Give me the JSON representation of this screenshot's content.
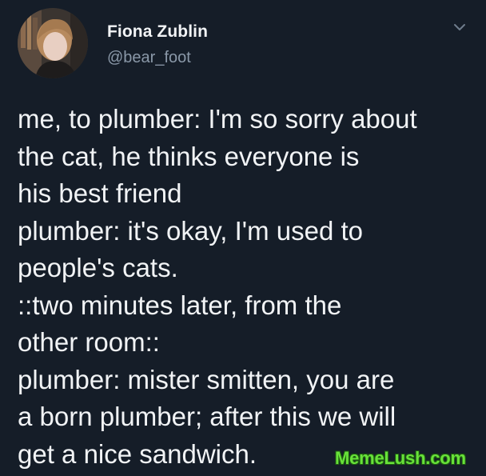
{
  "tweet": {
    "author": {
      "display_name": "Fiona Zublin",
      "handle": "@bear_foot",
      "avatar_icon": "profile-photo"
    },
    "menu_icon": "chevron-down-icon",
    "body_lines": [
      "me, to plumber: I'm so sorry about",
      "the cat, he thinks everyone is",
      "his best friend",
      "plumber: it's okay, I'm used to",
      "people's cats.",
      "::two minutes later, from the",
      "other room::",
      "plumber: mister smitten, you are",
      "a born plumber; after this we will",
      "get a nice sandwich."
    ]
  },
  "watermark": {
    "text": "MemeLush.com",
    "color": "#68e23a"
  },
  "colors": {
    "background": "#151d28",
    "text": "#f1f3f5",
    "secondary_text": "#8a98a8"
  }
}
